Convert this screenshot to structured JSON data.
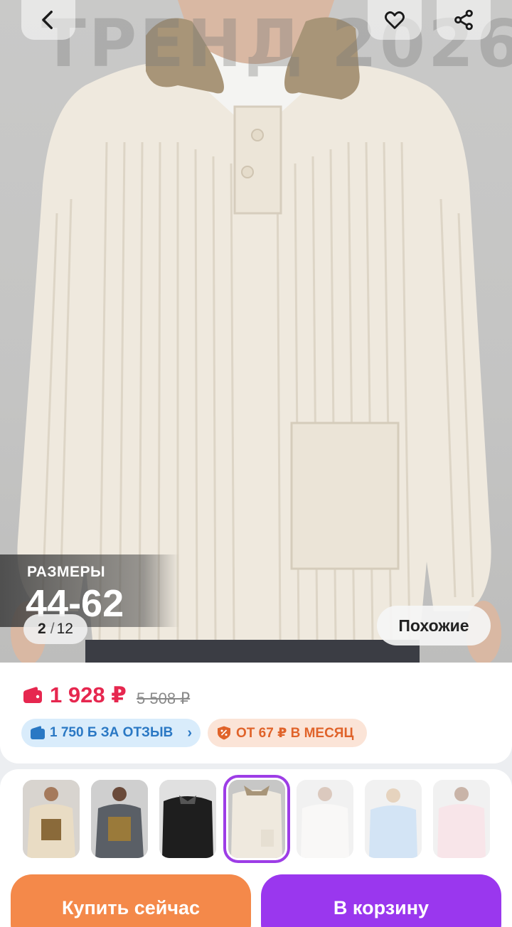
{
  "hero": {
    "watermark": "ТРЕНД 2026",
    "sizes_label": "РАЗМЕРЫ",
    "sizes_value": "44-62",
    "counter_current": "2",
    "counter_separator": "/",
    "counter_total": "12",
    "similar_label": "Похожие",
    "icons": [
      "chevron-left-icon",
      "heart-icon",
      "share-icon"
    ]
  },
  "price": {
    "current": "1 928 ₽",
    "old": "5 508 ₽",
    "accent_color": "#e6274f"
  },
  "chips": {
    "review_bonus": "1 750 Б ЗА ОТЗЫВ",
    "review_arrow": "›",
    "installment": "ОТ 67 ₽ В МЕСЯЦ"
  },
  "thumbnails": {
    "count": 7,
    "active_index": 3
  },
  "actions": {
    "buy_now": "Купить сейчас",
    "add_to_cart": "В корзину",
    "buy_color": "#f4894a",
    "cart_color": "#9a37ee"
  }
}
